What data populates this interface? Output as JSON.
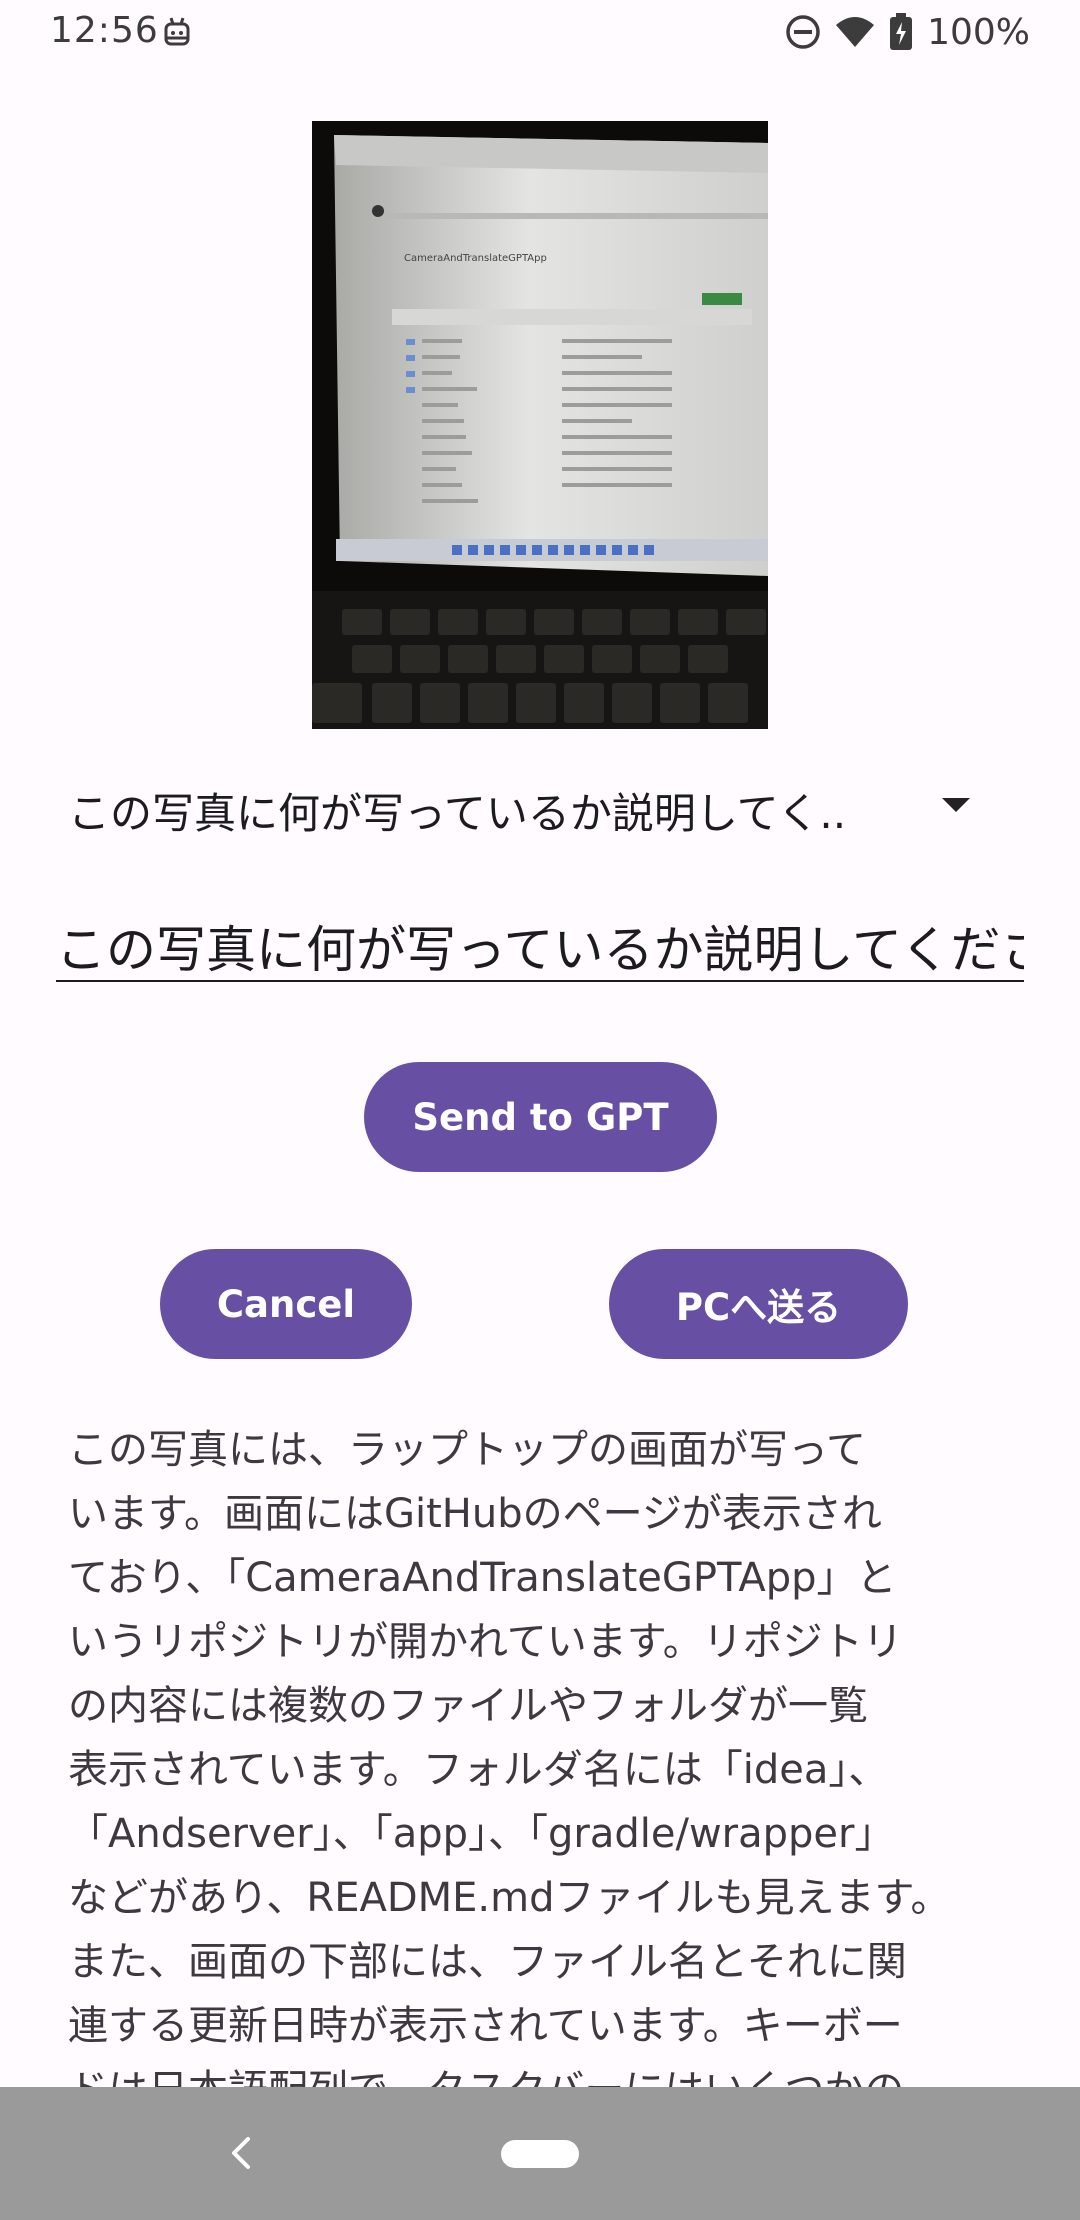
{
  "status_bar": {
    "time": "12:56",
    "battery": "100%",
    "icons": [
      "android-robot-icon",
      "do-not-disturb-icon",
      "wifi-icon",
      "battery-charging-icon"
    ]
  },
  "photo": {
    "icon": "photo-laptop-github-page",
    "repo_title": "CameraAndTranslateGPTApp"
  },
  "prompt_select": {
    "selected": "この写真に何が写っているか説明してく.."
  },
  "prompt_input": {
    "value": "この写真に何が写っているか説明してください"
  },
  "buttons": {
    "send": "Send to GPT",
    "cancel": "Cancel",
    "pc": "PCへ送る"
  },
  "response": {
    "text": "この写真には、ラップトップの画面が写って\nいます。画面にはGitHubのページが表示され\nており、「CameraAndTranslateGPTApp」と\nいうリポジトリが開かれています。リポジトリ\nの内容には複数のファイルやフォルダが一覧\n表示されています。フォルダ名には「idea」、\n「Andserver」、「app」、「gradle/wrapper」\nなどがあり、README.mdファイルも見えます。\nまた、画面の下部には、ファイル名とそれに関\n連する更新日時が表示されています。キーボー\nドは日本語配列で、タスクバーにはいくつかの"
  },
  "colors": {
    "primary": "#6750a4",
    "background": "#fffbfe",
    "nav_bar": "#9a9a9a"
  }
}
